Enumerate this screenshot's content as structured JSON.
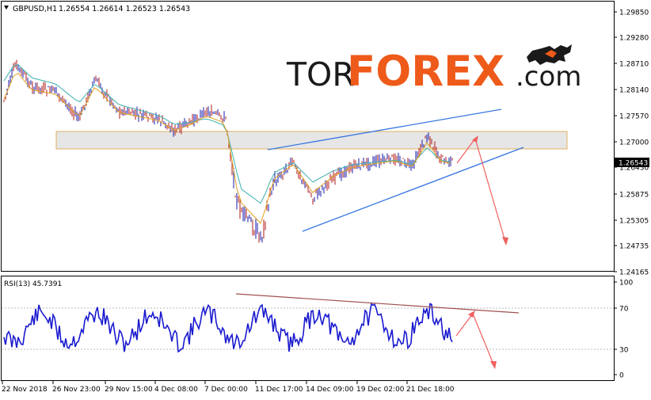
{
  "header": {
    "symbol": "GBPUSD,H1",
    "ohlc": "1.26554 1.26614 1.26523 1.26543"
  },
  "logo": {
    "text_part1": "TOR",
    "text_part2": "FOREX",
    "text_part3": ".com",
    "icon": "bull-bear-icon",
    "colors": {
      "dark": "#1a1a1a",
      "accent": "#ee5a1a"
    }
  },
  "price_axis": {
    "ticks": [
      "1.29850",
      "1.29280",
      "1.28710",
      "1.28140",
      "1.27570",
      "1.27000",
      "1.26543",
      "1.26430",
      "1.25875",
      "1.25305",
      "1.24735",
      "1.24165"
    ],
    "current_price": "1.26543"
  },
  "rsi": {
    "label": "RSI(13) 45.7391",
    "ticks": [
      "100",
      "70",
      "30",
      "0"
    ]
  },
  "time_axis": {
    "labels": [
      "22 Nov 2018",
      "26 Nov 23:00",
      "29 Nov 15:00",
      "4 Dec 08:00",
      "7 Dec 00:00",
      "11 Dec 17:00",
      "14 Dec 09:00",
      "19 Dec 02:00",
      "21 Dec 18:00"
    ]
  },
  "colors": {
    "bull": "#1a1aa8",
    "bear": "#b01818",
    "ma_teal": "#3cb0b0",
    "ma_orange": "#e0a020",
    "trend_blue": "#3a78e0",
    "arrow_red": "#f06060",
    "rsi_line": "#1a1ad0",
    "rsi_trend": "#a05050",
    "zone_fill": "#e6e6e6",
    "zone_border": "#e0b060"
  }
}
